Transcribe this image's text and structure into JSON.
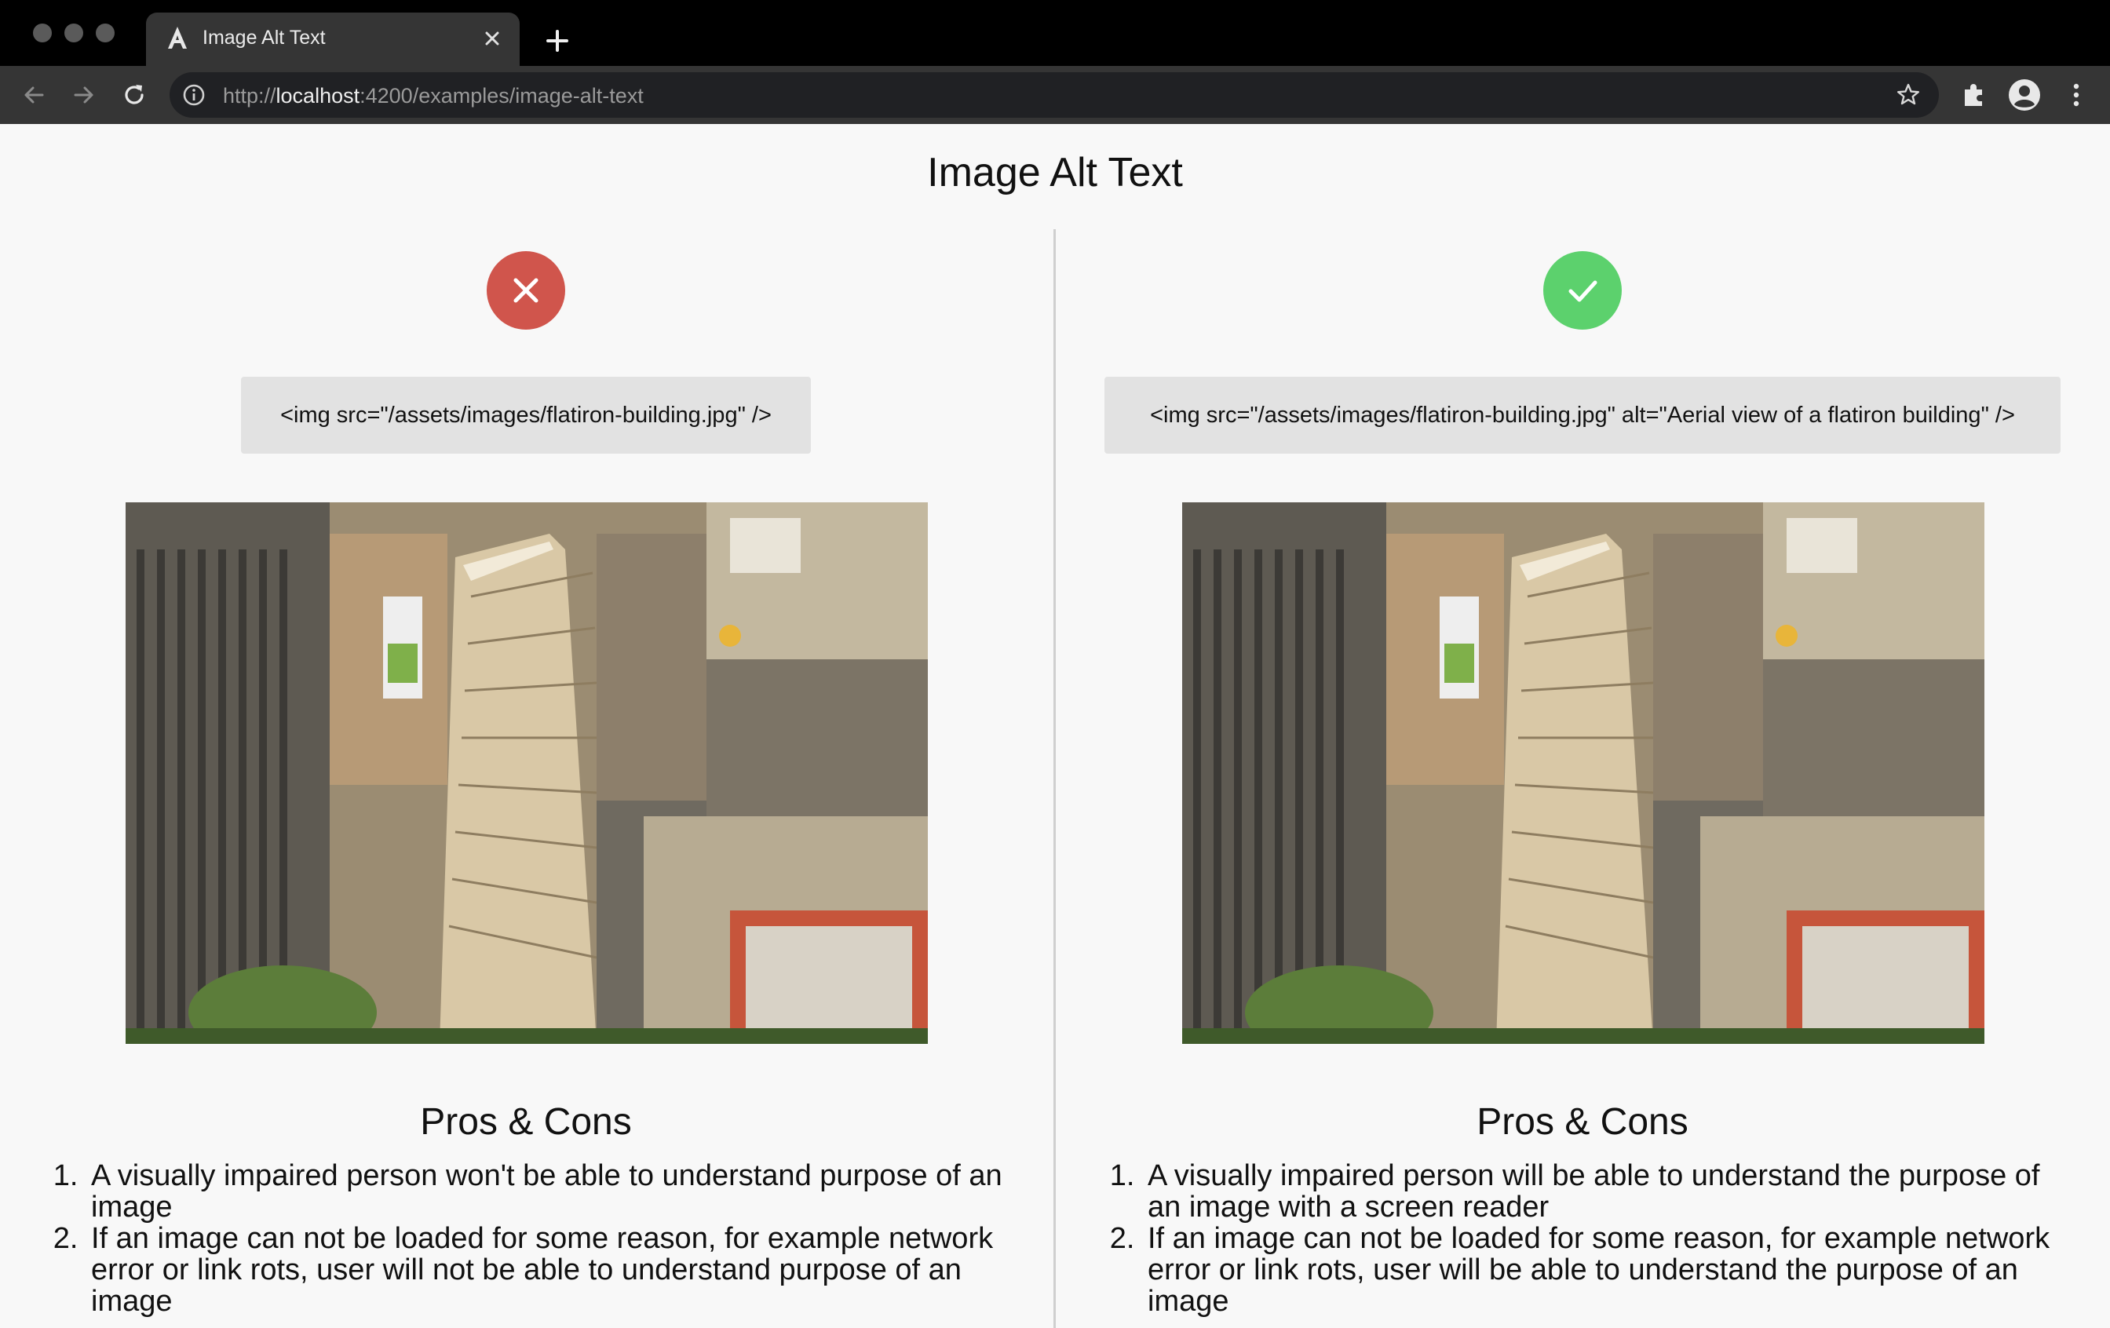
{
  "browser": {
    "tab_title": "Image Alt Text",
    "url_scheme": "http://",
    "url_host": "localhost",
    "url_path": ":4200/examples/image-alt-text"
  },
  "page": {
    "title": "Image Alt Text"
  },
  "bad_example": {
    "status_icon": "close-icon",
    "status_color": "#d0554c",
    "code": "<img src=\"/assets/images/flatiron-building.jpg\" />",
    "section_title": "Pros & Cons",
    "items": [
      "A visually impaired person won't be able to understand purpose of an image",
      "If an image can not be loaded for some reason, for example network error or link rots, user will not be able to understand purpose of an image"
    ]
  },
  "good_example": {
    "status_icon": "check-icon",
    "status_color": "#5cd16d",
    "code": "<img src=\"/assets/images/flatiron-building.jpg\" alt=\"Aerial view of a flatiron building\" />",
    "section_title": "Pros & Cons",
    "items": [
      "A visually impaired person will be able to understand the purpose of an image with a screen reader",
      "If an image can not be loaded for some reason, for example network error or link rots, user will be able to understand the purpose of an image"
    ]
  }
}
